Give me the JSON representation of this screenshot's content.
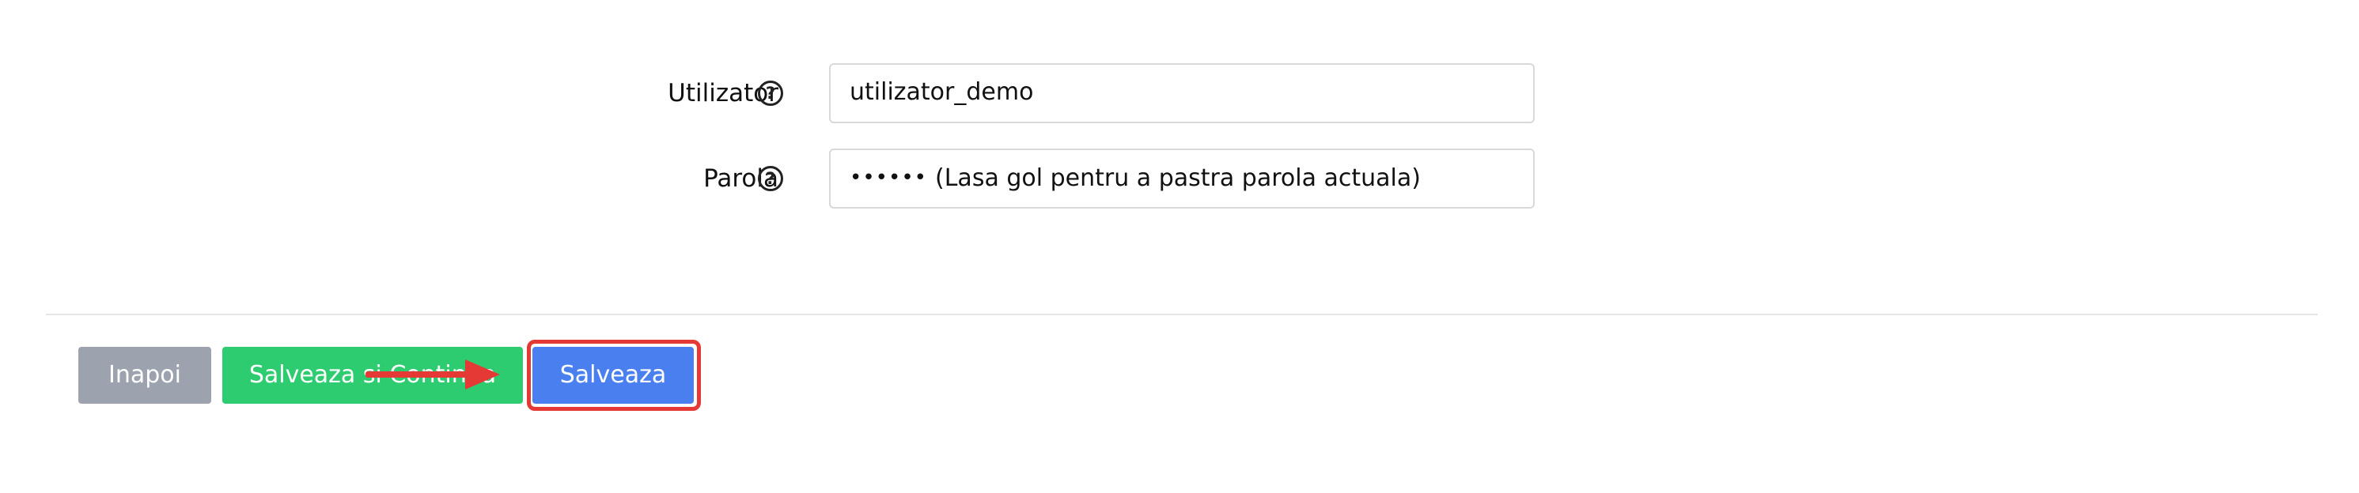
{
  "form": {
    "username": {
      "label": "Utilizator",
      "value": "utilizator_demo",
      "help_icon": "question-circle-icon"
    },
    "password": {
      "label": "Parola",
      "masked": "••••••",
      "hint": "(Lasa gol pentru a pastra parola actuala)",
      "help_icon": "question-circle-icon"
    }
  },
  "actions": {
    "back_label": "Inapoi",
    "save_continue_label": "Salveaza si Continua",
    "save_label": "Salveaza"
  },
  "colors": {
    "back_button": "#9ca3ae",
    "save_continue_button": "#2ecc71",
    "save_button": "#4a7ff0",
    "annotation": "#e53935"
  }
}
